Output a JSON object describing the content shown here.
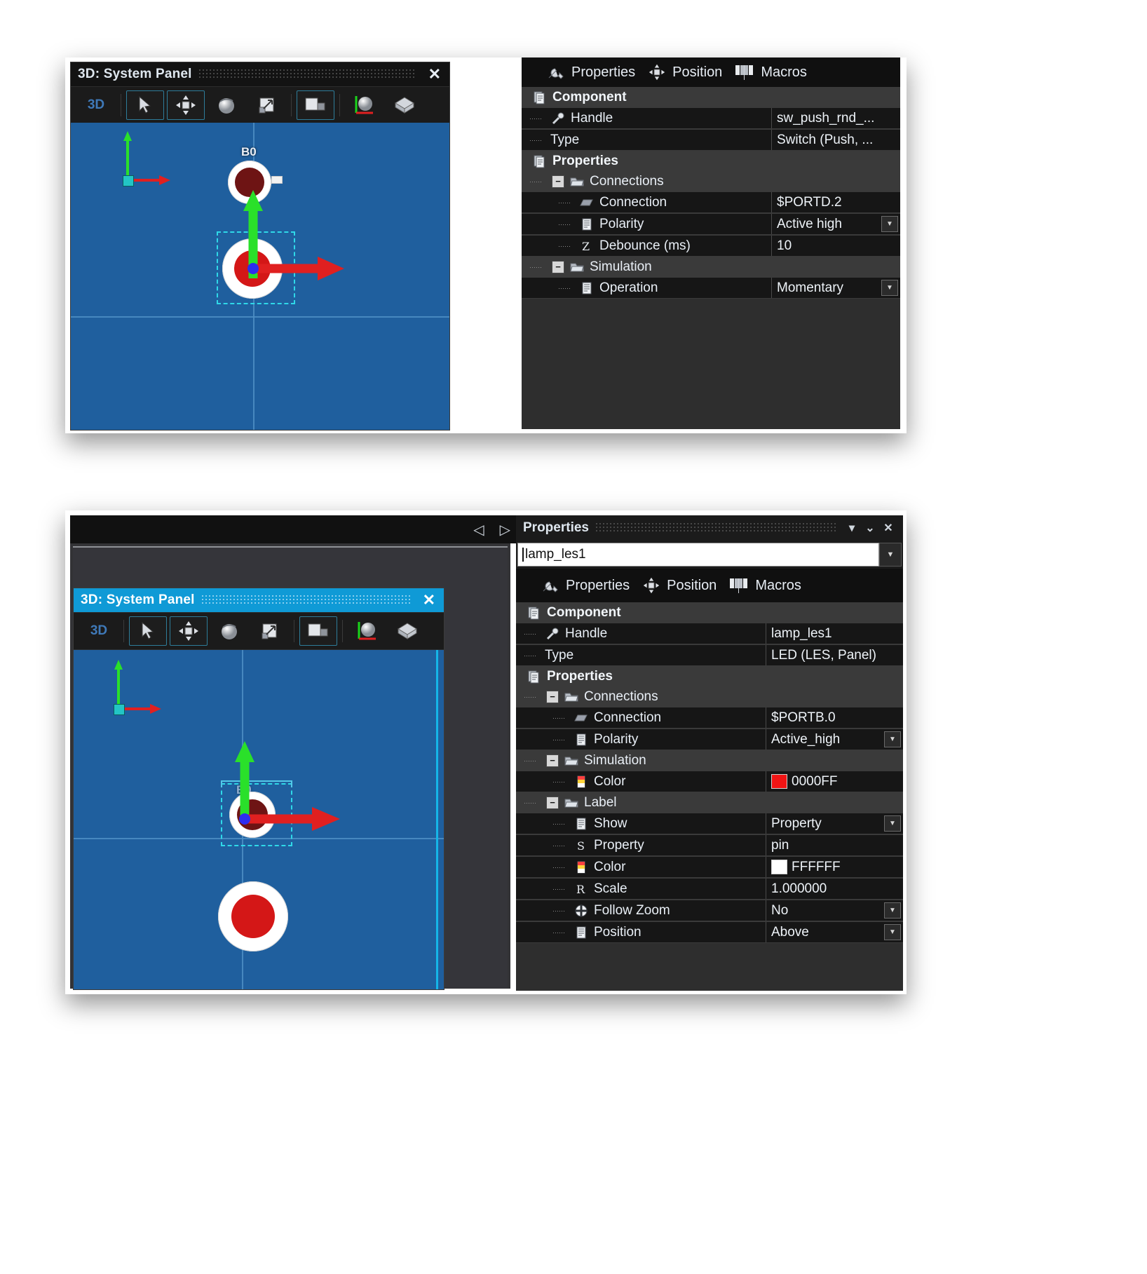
{
  "top_capture": {
    "viewport": {
      "title": "3D: System Panel",
      "close_label": "✕",
      "mode_label": "3D",
      "tools": [
        {
          "name": "select-tool",
          "selected": true
        },
        {
          "name": "move-tool",
          "selected": true
        },
        {
          "name": "rotate-tool",
          "selected": false
        },
        {
          "name": "scale-tool",
          "selected": false
        },
        {
          "name": "view-tool",
          "selected": true
        },
        {
          "name": "light-tool",
          "selected": false
        },
        {
          "name": "shape-tool",
          "selected": false
        }
      ],
      "component_label": "B0"
    },
    "properties": {
      "tabs": [
        {
          "label": "Properties",
          "icon": "wrench-icon"
        },
        {
          "label": "Position",
          "icon": "move-icon"
        },
        {
          "label": "Macros",
          "icon": "macros-icon"
        }
      ],
      "rows": [
        {
          "kind": "group",
          "label": "Component",
          "icon": "document-icon",
          "value": ""
        },
        {
          "kind": "leaf",
          "indent": 1,
          "label": "Handle",
          "icon": "wrench-small-icon",
          "value": "sw_push_rnd_..."
        },
        {
          "kind": "leaf",
          "indent": 1,
          "label": "Type",
          "icon": "none",
          "value": "Switch (Push, ..."
        },
        {
          "kind": "group",
          "label": "Properties",
          "icon": "document-icon",
          "value": ""
        },
        {
          "kind": "sub",
          "indent": 1,
          "label": "Connections",
          "icon": "folder-icon",
          "value": "",
          "expanded": true
        },
        {
          "kind": "leaf",
          "indent": 2,
          "label": "Connection",
          "icon": "connection-icon",
          "value": "$PORTD.2"
        },
        {
          "kind": "leaf",
          "indent": 2,
          "label": "Polarity",
          "icon": "list-icon",
          "value": "Active high",
          "dropdown": true
        },
        {
          "kind": "leaf",
          "indent": 2,
          "label": "Debounce (ms)",
          "icon": "integer-icon",
          "value": "10"
        },
        {
          "kind": "sub",
          "indent": 1,
          "label": "Simulation",
          "icon": "folder-icon",
          "value": "",
          "expanded": true
        },
        {
          "kind": "leaf",
          "indent": 2,
          "label": "Operation",
          "icon": "list-icon",
          "value": "Momentary",
          "dropdown": true
        }
      ]
    }
  },
  "bottom_capture": {
    "nav": {
      "prev": "◁",
      "next": "▷"
    },
    "viewport": {
      "title": "3D: System Panel",
      "close_label": "✕",
      "mode_label": "3D",
      "component_label": "B0"
    },
    "properties": {
      "panel_title": "Properties",
      "collapse_icon": "▾",
      "pin_icon": "✕",
      "close_icon": "✕",
      "name_value": "lamp_les1",
      "tabs": [
        {
          "label": "Properties",
          "icon": "wrench-icon"
        },
        {
          "label": "Position",
          "icon": "move-icon"
        },
        {
          "label": "Macros",
          "icon": "macros-icon"
        }
      ],
      "rows": [
        {
          "kind": "group",
          "label": "Component",
          "icon": "document-icon",
          "value": ""
        },
        {
          "kind": "leaf",
          "indent": 1,
          "label": "Handle",
          "icon": "wrench-small-icon",
          "value": "lamp_les1"
        },
        {
          "kind": "leaf",
          "indent": 1,
          "label": "Type",
          "icon": "none",
          "value": "LED (LES, Panel)"
        },
        {
          "kind": "group",
          "label": "Properties",
          "icon": "document-icon",
          "value": ""
        },
        {
          "kind": "sub",
          "indent": 1,
          "label": "Connections",
          "icon": "folder-icon",
          "value": "",
          "expanded": true
        },
        {
          "kind": "leaf",
          "indent": 2,
          "label": "Connection",
          "icon": "connection-icon",
          "value": "$PORTB.0"
        },
        {
          "kind": "leaf",
          "indent": 2,
          "label": "Polarity",
          "icon": "list-icon",
          "value": "Active_high",
          "dropdown": true
        },
        {
          "kind": "sub",
          "indent": 1,
          "label": "Simulation",
          "icon": "folder-icon",
          "value": "",
          "expanded": true
        },
        {
          "kind": "leaf",
          "indent": 2,
          "label": "Color",
          "icon": "color-icon",
          "value": "0000FF",
          "swatch": "#f01414"
        },
        {
          "kind": "sub",
          "indent": 1,
          "label": "Label",
          "icon": "folder-icon",
          "value": "",
          "expanded": true
        },
        {
          "kind": "leaf",
          "indent": 2,
          "label": "Show",
          "icon": "list-icon",
          "value": "Property",
          "dropdown": true
        },
        {
          "kind": "leaf",
          "indent": 2,
          "label": "Property",
          "icon": "string-icon",
          "value": "pin"
        },
        {
          "kind": "leaf",
          "indent": 2,
          "label": "Color",
          "icon": "color-icon",
          "value": "FFFFFF",
          "swatch": "#ffffff"
        },
        {
          "kind": "leaf",
          "indent": 2,
          "label": "Scale",
          "icon": "real-icon",
          "value": "1.000000"
        },
        {
          "kind": "leaf",
          "indent": 2,
          "label": "Follow Zoom",
          "icon": "plus-circle-icon",
          "value": "No",
          "dropdown": true
        },
        {
          "kind": "leaf",
          "indent": 2,
          "label": "Position",
          "icon": "list-icon",
          "value": "Above",
          "dropdown": true
        }
      ]
    }
  },
  "colors": {
    "viewport_bg": "#1f5f9e",
    "grid": "#4f8fc4",
    "axis_green": "#2ae02a",
    "axis_red": "#e02020",
    "selection": "#2fd8e8",
    "panel_bg": "#262626",
    "row_group": "#3a3a3a",
    "row_leaf": "#161616",
    "text": "#e9eff6",
    "accent_blue": "#3f79b8",
    "led_dark_red": "#6e1414",
    "led_bright_red": "#d41717"
  }
}
